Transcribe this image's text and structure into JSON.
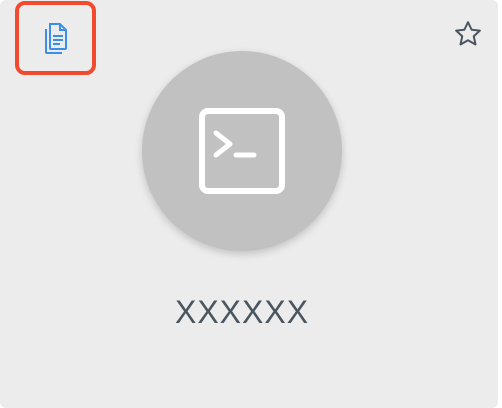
{
  "card": {
    "title": "XXXXXX",
    "icons": {
      "copy": "copy-document-icon",
      "favorite": "star-outline-icon",
      "app": "terminal-icon"
    },
    "colors": {
      "copy_icon": "#3b8fe8",
      "highlight_border": "#f24a2e",
      "avatar_bg": "#c1c1c1",
      "card_bg": "#ececec",
      "title_text": "#4a5560"
    }
  }
}
